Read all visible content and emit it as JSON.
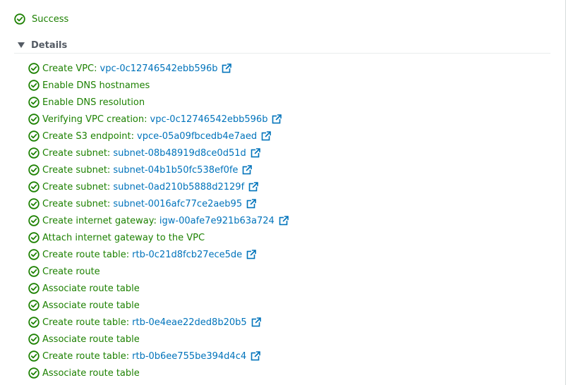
{
  "status": {
    "label": "Success",
    "color": "#1d8102"
  },
  "details": {
    "title": "Details"
  },
  "colors": {
    "success": "#1d8102",
    "link": "#0073bb",
    "text": "#545b64"
  },
  "steps": [
    {
      "label": "Create VPC:",
      "link": "vpc-0c12746542ebb596b"
    },
    {
      "label": "Enable DNS hostnames",
      "link": ""
    },
    {
      "label": "Enable DNS resolution",
      "link": ""
    },
    {
      "label": "Verifying VPC creation:",
      "link": "vpc-0c12746542ebb596b"
    },
    {
      "label": "Create S3 endpoint:",
      "link": "vpce-05a09fbcedb4e7aed"
    },
    {
      "label": "Create subnet:",
      "link": "subnet-08b48919d8ce0d51d"
    },
    {
      "label": "Create subnet:",
      "link": "subnet-04b1b50fc538ef0fe"
    },
    {
      "label": "Create subnet:",
      "link": "subnet-0ad210b5888d2129f"
    },
    {
      "label": "Create subnet:",
      "link": "subnet-0016afc77ce2aeb95"
    },
    {
      "label": "Create internet gateway:",
      "link": "igw-00afe7e921b63a724"
    },
    {
      "label": "Attach internet gateway to the VPC",
      "link": ""
    },
    {
      "label": "Create route table:",
      "link": "rtb-0c21d8fcb27ece5de"
    },
    {
      "label": "Create route",
      "link": ""
    },
    {
      "label": "Associate route table",
      "link": ""
    },
    {
      "label": "Associate route table",
      "link": ""
    },
    {
      "label": "Create route table:",
      "link": "rtb-0e4eae22ded8b20b5"
    },
    {
      "label": "Associate route table",
      "link": ""
    },
    {
      "label": "Create route table:",
      "link": "rtb-0b6ee755be394d4c4"
    },
    {
      "label": "Associate route table",
      "link": ""
    }
  ]
}
